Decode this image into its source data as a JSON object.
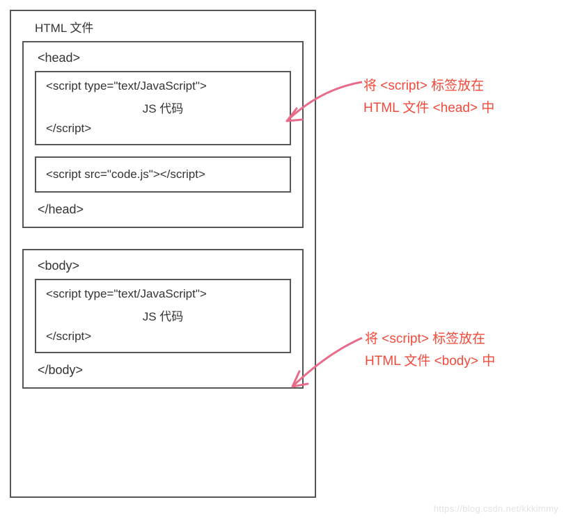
{
  "diagram": {
    "outer_title": "HTML 文件",
    "head": {
      "open_tag": "<head>",
      "script_block": {
        "open": "<script type=\"text/JavaScript\">",
        "content": "JS 代码",
        "close": "</script>"
      },
      "external_script": "<script src=\"code.js\"></script>",
      "close_tag": "</head>"
    },
    "body": {
      "open_tag": "<body>",
      "script_block": {
        "open": "<script type=\"text/JavaScript\">",
        "content": "JS 代码",
        "close": "</script>"
      },
      "close_tag": "</body>"
    }
  },
  "annotations": {
    "head_note_line1": "将 <script> 标签放在",
    "head_note_line2": "HTML 文件 <head> 中",
    "body_note_line1": "将 <script> 标签放在",
    "body_note_line2": "HTML 文件 <body> 中"
  },
  "watermark": "https://blog.csdn.net/kkkimmy",
  "colors": {
    "border": "#555555",
    "annotation": "#f24a3a",
    "arrow": "#e86b8a"
  }
}
